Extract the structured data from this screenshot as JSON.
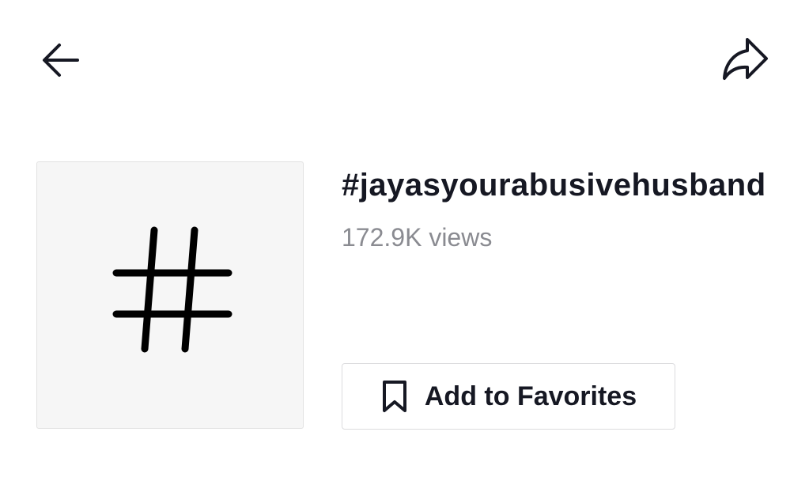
{
  "header": {
    "back_icon": "arrow-left-icon",
    "share_icon": "share-arrow-icon"
  },
  "hashtag": {
    "icon": "hashtag-icon",
    "title": "#jayasyourabusivehusband",
    "views": "172.9K views"
  },
  "favorite_button": {
    "icon": "bookmark-icon",
    "label": "Add to Favorites"
  },
  "colors": {
    "text_primary": "#161823",
    "text_secondary": "#8a8b91",
    "border": "#dcdcde",
    "thumbnail_bg": "#f6f6f6"
  }
}
